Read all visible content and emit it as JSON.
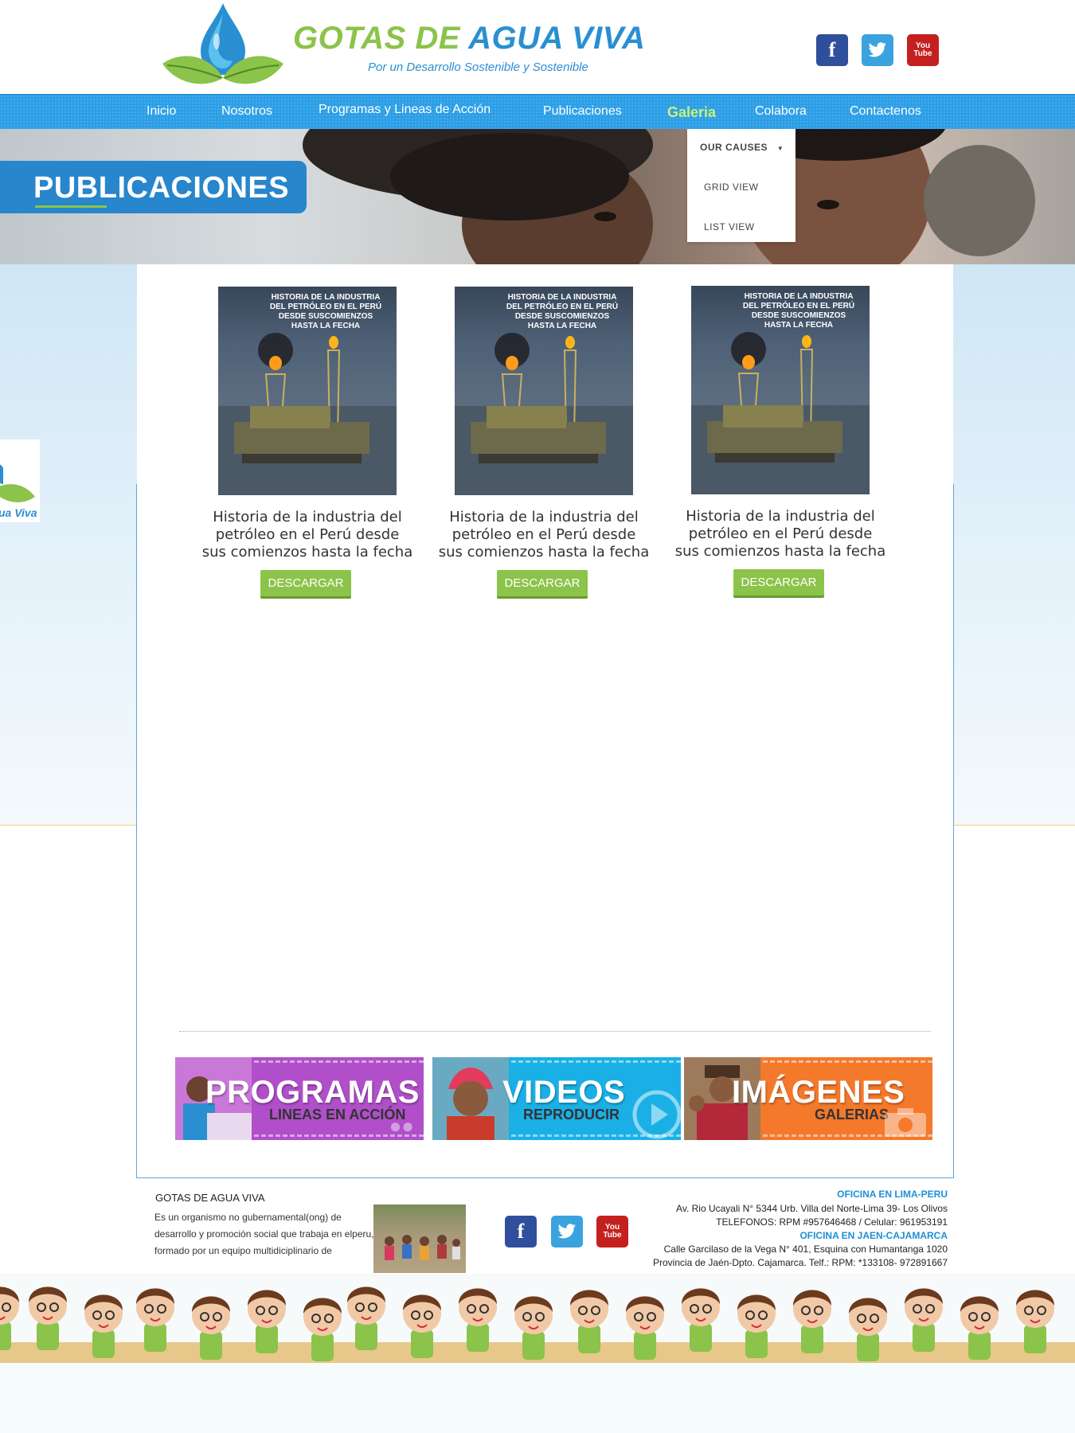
{
  "header": {
    "title_part1": "GOTAS DE",
    "title_part2": "AGUA VIVA",
    "tagline": "Por un Desarrollo Sostenible y Sostenible",
    "social": {
      "facebook": "f",
      "youtube_line1": "You",
      "youtube_line2": "Tube"
    }
  },
  "nav": {
    "items": [
      "Inicio",
      "Nosotros",
      "Programas y Lineas de Acción",
      "Publicaciones",
      "Galeria",
      "Colabora",
      "Contactenos"
    ],
    "active": "Galeria"
  },
  "dropdown": {
    "items": [
      "OUR CAUSES",
      "GRID VIEW",
      "LIST VIEW"
    ]
  },
  "hero": {
    "title": "PUBLICACIONES"
  },
  "side_tab": {
    "text": "ua Viva"
  },
  "publications": [
    {
      "cover_text": "HISTORIA DE LA INDUSTRIA DEL PETRÓLEO EN EL PERÚ DESDE SUSCOMIENZOS HASTA LA FECHA",
      "title_line1": "Historia de la industria del",
      "title_line2": "petróleo en el Perú desde",
      "title_line3": "sus comienzos hasta la fecha",
      "button": "DESCARGAR"
    },
    {
      "cover_text": "HISTORIA DE LA INDUSTRIA DEL PETRÓLEO EN EL PERÚ DESDE SUSCOMIENZOS HASTA LA FECHA",
      "title_line1": "Historia de la industria del",
      "title_line2": "petróleo en el Perú desde",
      "title_line3": "sus comienzos hasta la fecha",
      "button": "DESCARGAR"
    },
    {
      "cover_text": "HISTORIA DE LA INDUSTRIA DEL PETRÓLEO EN EL PERÚ DESDE SUSCOMIENZOS HASTA LA FECHA",
      "title_line1": "Historia de la industria del",
      "title_line2": "petróleo en el Perú desde",
      "title_line3": "sus comienzos hasta la fecha",
      "button": "DESCARGAR"
    }
  ],
  "banners": [
    {
      "big": "PROGRAMAS",
      "small": "LINEAS EN ACCIÓN",
      "color": "#b04fc9"
    },
    {
      "big": "VIDEOS",
      "small": "REPRODUCIR",
      "color": "#1ab0e6"
    },
    {
      "big": "IMÁGENES",
      "small": "GALERIAS",
      "color": "#f5792a"
    }
  ],
  "footer": {
    "title": "GOTAS DE AGUA VIVA",
    "description": "Es un organismo no gubernamental(ong) de desarrollo y promoción social que trabaja en elperu, formado por un equipo multidiciplinario de profesionales en las diferentes areas sociales y tecnicas, que promueve el desarrollo.",
    "office1_head": "OFICINA EN LIMA-PERU",
    "office1_line1": "Av. Rio Ucayali N° 5344 Urb. Villa del Norte-Lima 39- Los Olivos",
    "office1_line2": "TELEFONOS: RPM #957646468 / Celular: 961953191",
    "office2_head": "OFICINA EN JAEN-CAJAMARCA",
    "office2_line1": "Calle Garcilaso de la Vega N° 401, Esquina con Humantanga 1020",
    "office2_line2": "Provincia de Jaén-Dpto. Cajamarca. Telf.: RPM: *133108- 972891667"
  },
  "colors": {
    "brand_blue": "#2a8fd0",
    "brand_green": "#8cc34a",
    "nav_blue": "#2b9ee6"
  }
}
